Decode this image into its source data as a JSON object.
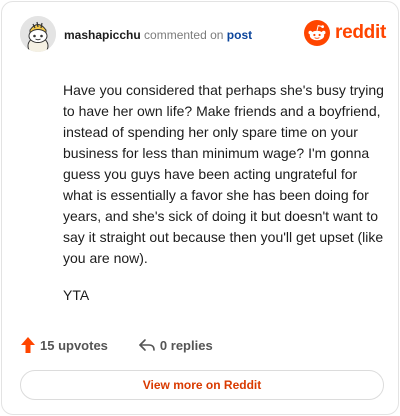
{
  "header": {
    "username": "mashapicchu",
    "action_text": "commented on",
    "post_link": "post",
    "brand": "reddit",
    "avatar_icon": "snoo-avatar-icon",
    "brand_icon": "reddit-logo-icon"
  },
  "comment": {
    "paragraphs": [
      "Have you considered that perhaps she's busy trying to have her own life? Make friends and a boyfriend, instead of spending her only spare time on your business for less than minimum wage? I'm gonna guess you guys have been acting ungrateful for what is essentially a favor she has been doing for years, and she's sick of doing it but doesn't want to say it straight out because then you'll get upset (like you are now).",
      "YTA"
    ]
  },
  "actions": {
    "upvotes": "15 upvotes",
    "upvote_icon": "upvote-arrow-icon",
    "replies": "0 replies",
    "reply_icon": "reply-arrow-icon"
  },
  "footer": {
    "view_more": "View more on Reddit"
  },
  "colors": {
    "brand": "#ff4500",
    "link": "#0a449b",
    "button_text": "#d93a00"
  }
}
